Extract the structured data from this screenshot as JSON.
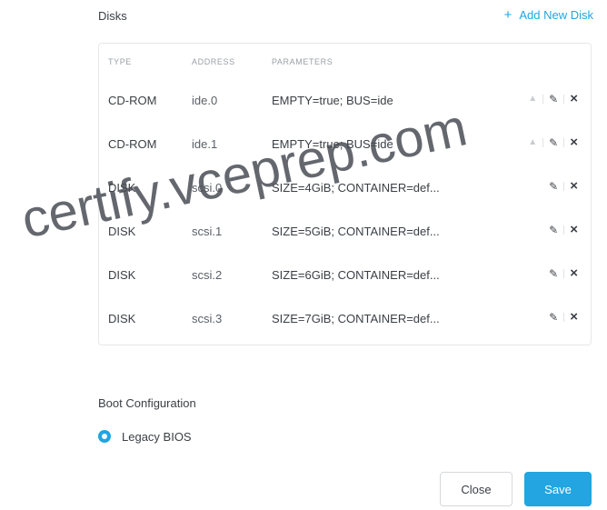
{
  "disks": {
    "title": "Disks",
    "add_label": "Add New Disk",
    "add_icon": "+",
    "columns": {
      "type": "TYPE",
      "address": "ADDRESS",
      "parameters": "PARAMETERS"
    },
    "rows": [
      {
        "type": "CD-ROM",
        "address": "ide.0",
        "parameters": "EMPTY=true; BUS=ide"
      },
      {
        "type": "CD-ROM",
        "address": "ide.1",
        "parameters": "EMPTY=true; BUS=ide"
      },
      {
        "type": "DISK",
        "address": "scsi.0",
        "parameters": "SIZE=4GiB; CONTAINER=def..."
      },
      {
        "type": "DISK",
        "address": "scsi.1",
        "parameters": "SIZE=5GiB; CONTAINER=def..."
      },
      {
        "type": "DISK",
        "address": "scsi.2",
        "parameters": "SIZE=6GiB; CONTAINER=def..."
      },
      {
        "type": "DISK",
        "address": "scsi.3",
        "parameters": "SIZE=7GiB; CONTAINER=def..."
      }
    ],
    "action_icons": {
      "move": "up-arrow-icon",
      "edit": "pencil-icon",
      "delete": "close-icon"
    }
  },
  "boot": {
    "title": "Boot Configuration",
    "option_label": "Legacy BIOS"
  },
  "footer": {
    "close_label": "Close",
    "save_label": "Save"
  },
  "watermark": "certify.vceprep.com",
  "colors": {
    "accent": "#22a5e0",
    "text": "#3b3f45",
    "muted": "#9aa0a6",
    "border": "#e6e8ea"
  }
}
